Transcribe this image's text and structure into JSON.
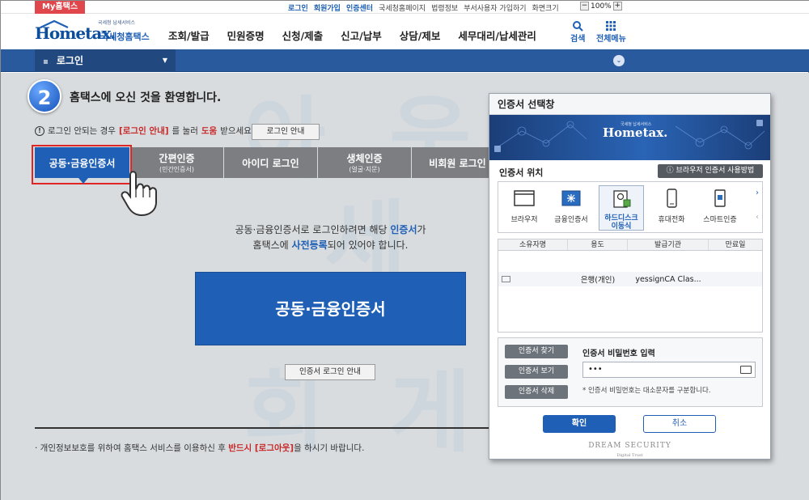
{
  "topbar": {
    "my_hometax": "My홈택스",
    "links": [
      "로그인",
      "회원가입",
      "인증센터",
      "국세청홈페이지",
      "법령정보",
      "부서사용자 가입하기",
      "화면크기"
    ],
    "zoom_minus": "−",
    "zoom_value": "100%",
    "zoom_plus": "+"
  },
  "header": {
    "logo_sub": "국세청 납세서비스",
    "logo_main": "Hometax.",
    "logo_kr": "국세청홈택스",
    "menu": [
      "조회/발급",
      "민원증명",
      "신청/제출",
      "신고/납부",
      "상담/제보",
      "세무대리/납세관리"
    ],
    "search_label": "검색",
    "all_menu_label": "전체메뉴"
  },
  "bluebar": {
    "current": "로그인"
  },
  "main": {
    "step_number": "2",
    "welcome": "홈택스에 오신 것을 환영합니다.",
    "notice_pre": "로그인 안되는 경우",
    "notice_red": "[로그인 안내]",
    "notice_mid": "를 눌러",
    "notice_red2": "도움",
    "notice_post": "받으세요.",
    "login_guide_button": "로그인 안내",
    "tabs": [
      {
        "label": "공동·금융인증서",
        "sub": ""
      },
      {
        "label": "간편인증",
        "sub": "(민간인증서)"
      },
      {
        "label": "아이디 로그인",
        "sub": ""
      },
      {
        "label": "생체인증",
        "sub": "(얼굴·지문)"
      },
      {
        "label": "비회원 로그인",
        "sub": ""
      }
    ],
    "desc_line1_pre": "공동·금융인증서로 로그인하려면 해당",
    "desc_line1_hl": "인증서",
    "desc_line1_post": "가",
    "desc_line2_pre": "홈택스에",
    "desc_line2_hl": "사전등록",
    "desc_line2_post": "되어 있어야 합니다.",
    "big_button": "공동·금융인증서",
    "cert_login_guide": "인증서 로그인 안내",
    "footer_pre": "· 개인정보보호를 위하여 홈택스 서비스를 이용하신 후",
    "footer_red": "반드시 [로그아웃]",
    "footer_post": "을 하시기 바랍니다.",
    "watermark": [
      "아",
      "웃",
      "세",
      "회",
      "게"
    ]
  },
  "modal": {
    "title": "인증서 선택창",
    "logo_sub": "국세청 납세서비스",
    "logo": "Hometax.",
    "location_label": "인증서 위치",
    "browser_guide": "브라우저 인증서 사용방법",
    "locations": [
      {
        "label": "브라우저",
        "icon": "browser-icon"
      },
      {
        "label": "금융인증서",
        "icon": "financial-cert-icon"
      },
      {
        "label": "하드디스크\n이동식",
        "icon": "harddisk-icon"
      },
      {
        "label": "휴대전화",
        "icon": "phone-icon"
      },
      {
        "label": "스마트인증",
        "icon": "smart-cert-icon"
      }
    ],
    "table_headers": [
      "소유자명",
      "용도",
      "발급기관",
      "만료일"
    ],
    "cert_row": {
      "owner": "",
      "usage": "은행(개인)",
      "issuer": "yessignCA Clas...",
      "expiry": ""
    },
    "btn_find": "인증서 찾기",
    "btn_view": "인증서 보기",
    "btn_delete": "인증서 삭제",
    "pw_label": "인증서 비밀번호 입력",
    "pw_value": "•••",
    "pw_note": "* 인증서 비밀번호는 대소문자를 구분합니다.",
    "ok": "확인",
    "cancel": "취소",
    "footer": "DREAM SECURITY",
    "footer_small": "Digital Trust"
  },
  "colors": {
    "primary": "#1f5fb5",
    "bar": "#2a5a9e",
    "tab_inactive": "#7c7e82",
    "alert_red": "#c82828",
    "highlight_box": "#e02525"
  }
}
